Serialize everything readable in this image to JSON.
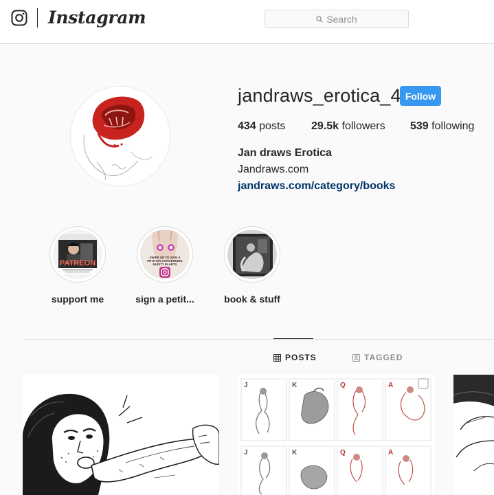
{
  "header": {
    "brand": "Instagram",
    "search_placeholder": "Search",
    "icons": {
      "logo": "instagram-camera-glyph",
      "search": "magnifier-icon"
    }
  },
  "profile": {
    "username": "jandraws_erotica_4",
    "follow_label": "Follow",
    "stats": [
      {
        "value": "434",
        "label": "posts"
      },
      {
        "value": "29.5k",
        "label": "followers"
      },
      {
        "value": "539",
        "label": "following"
      }
    ],
    "full_name": "Jan draws Erotica",
    "bio": "Jandraws.com",
    "link": "jandraws.com/category/books"
  },
  "highlights": [
    {
      "label": "support me",
      "thumb_text": "PATREON"
    },
    {
      "label": "sign a petit...",
      "thumb_text": "SWIPE UP TO SIGN A PETITION CONCERNING NUDITY IN ARTS"
    },
    {
      "label": "book & stuff"
    }
  ],
  "tabs": [
    {
      "label": "POSTS",
      "icon": "grid-icon",
      "active": true
    },
    {
      "label": "TAGGED",
      "icon": "tag-icon",
      "active": false
    }
  ],
  "posts": [
    {
      "kind": "sketch-portrait"
    },
    {
      "kind": "playing-cards",
      "card_ranks": [
        "J",
        "K",
        "Q",
        "A"
      ]
    },
    {
      "kind": "sketch-partial"
    }
  ],
  "colors": {
    "accent": "#3897f0",
    "link": "#003569",
    "text": "#262626",
    "muted": "#8e8e8e",
    "border": "#dbdbdb",
    "background": "#fafafa"
  }
}
